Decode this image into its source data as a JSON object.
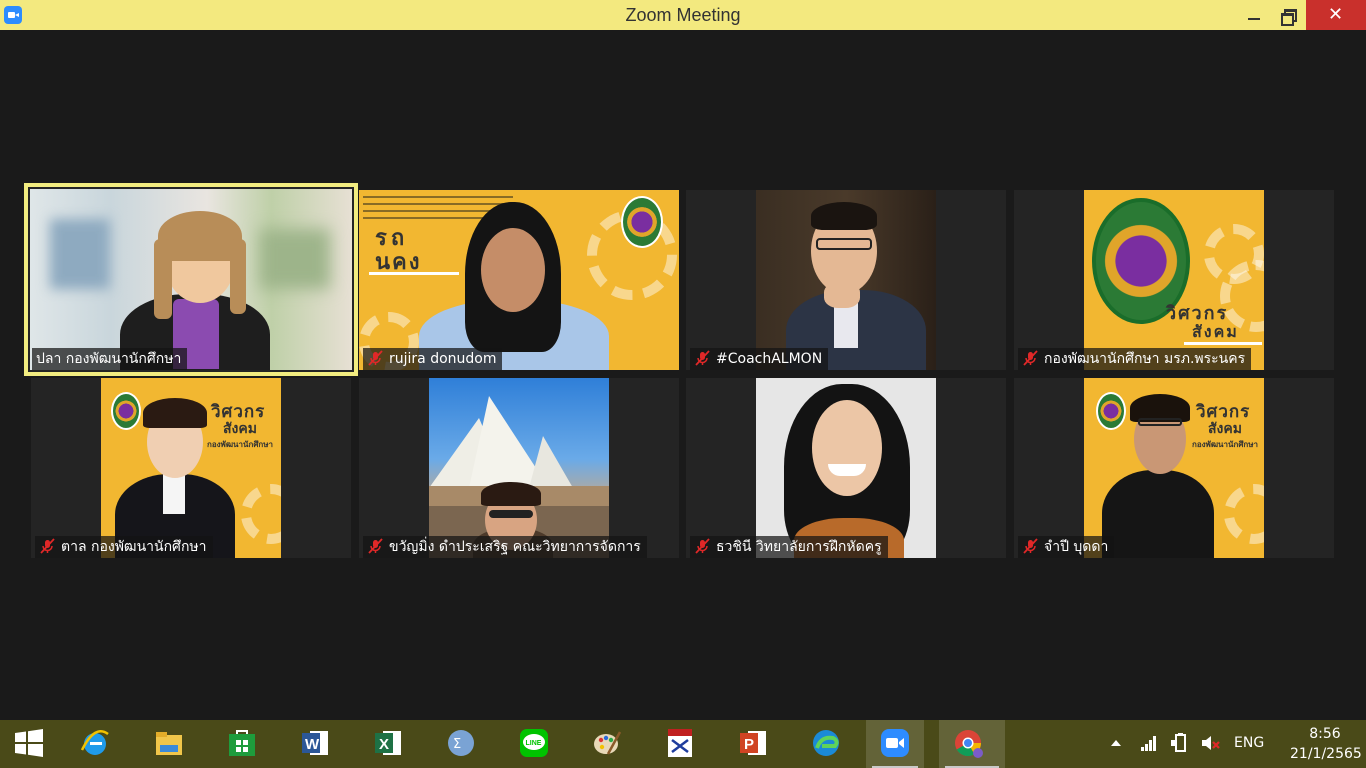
{
  "window": {
    "title": "Zoom Meeting",
    "close_glyph": "✕"
  },
  "participants": [
    {
      "name": "ปลา  กองพัฒนานักศึกษา",
      "muted": false,
      "active_speaker": true
    },
    {
      "name": "rujira donudom",
      "muted": true,
      "active_speaker": false
    },
    {
      "name": "#CoachALMON",
      "muted": true,
      "active_speaker": false
    },
    {
      "name": "กองพัฒนานักศึกษา มรภ.พระนคร",
      "muted": true,
      "active_speaker": false
    },
    {
      "name": "ตาล กองพัฒนานักศึกษา",
      "muted": true,
      "active_speaker": false
    },
    {
      "name": "ขวัญมิ่ง ดำประเสริฐ คณะวิทยาการจัดการ",
      "muted": true,
      "active_speaker": false
    },
    {
      "name": "ธวชินี  วิทยาลัยการฝึกหัดครู",
      "muted": true,
      "active_speaker": false
    },
    {
      "name": "จำปี บุดดา",
      "muted": true,
      "active_speaker": false
    }
  ],
  "posters": {
    "big_a": "รถ",
    "big_b": "นคง",
    "wichakorn": "วิศวกร",
    "sangkom": "สังคม",
    "dept": "กองพัฒนานักศึกษา"
  },
  "taskbar": {
    "apps": [
      "windows-start",
      "internet-explorer",
      "file-explorer",
      "store",
      "word",
      "excel",
      "math-input",
      "line",
      "paint",
      "lisrel",
      "powerpoint",
      "edge",
      "zoom",
      "chrome"
    ],
    "running": [
      "zoom",
      "chrome"
    ],
    "language": "ENG",
    "time": "8:56",
    "date": "21/1/2565"
  },
  "colors": {
    "titlebar": "#f3e97f",
    "active_border": "#f2ec80",
    "poster": "#f2b731",
    "mute_red": "#e02828"
  }
}
